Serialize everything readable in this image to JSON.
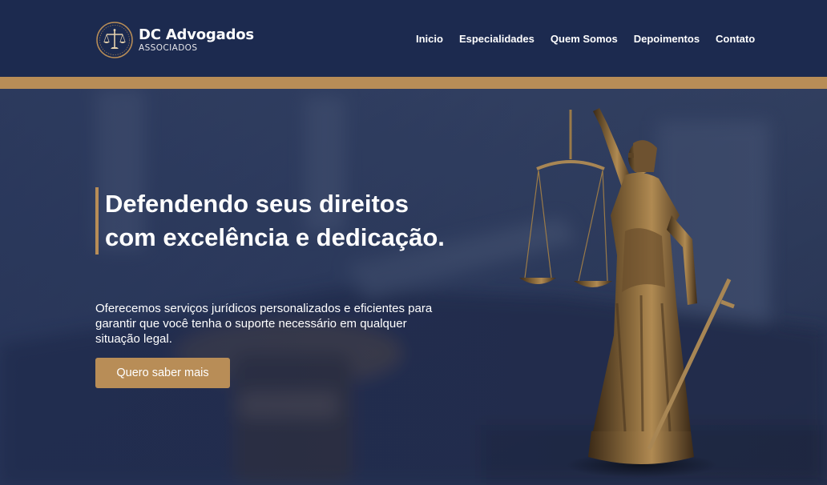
{
  "brand": {
    "name": "DC Advogados",
    "tagline": "ASSOCIADOS",
    "emblem_icon": "scales-of-justice-icon"
  },
  "nav": {
    "items": [
      {
        "label": "Inicio"
      },
      {
        "label": "Especialidades"
      },
      {
        "label": "Quem Somos"
      },
      {
        "label": "Depoimentos"
      },
      {
        "label": "Contato"
      }
    ]
  },
  "hero": {
    "headline": "Defendendo seus direitos com excelência e dedicação.",
    "subtitle": "Oferecemos serviços jurídicos personalizados e eficientes para garantir que você tenha o suporte necessário em qualquer situação legal.",
    "cta_label": "Quero saber mais",
    "image_subject": "lady-justice-statue"
  },
  "colors": {
    "header_bg": "#1c2a4f",
    "accent_gold": "#b88d57",
    "text": "#ffffff"
  }
}
